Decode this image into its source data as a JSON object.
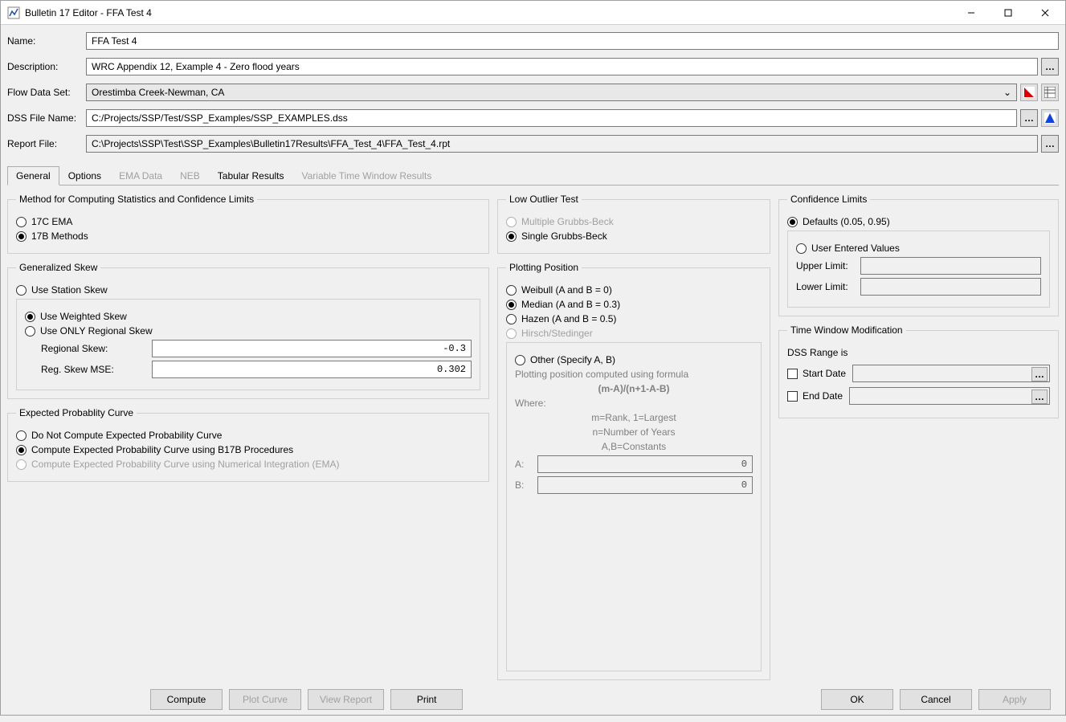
{
  "window": {
    "title": "Bulletin 17 Editor - FFA Test 4"
  },
  "form": {
    "name_label": "Name:",
    "name_value": "FFA Test 4",
    "desc_label": "Description:",
    "desc_value": "WRC Appendix 12, Example 4 - Zero flood years",
    "flow_label": "Flow Data Set:",
    "flow_value": "Orestimba Creek-Newman, CA",
    "dss_label": "DSS File Name:",
    "dss_value": "C:/Projects/SSP/Test/SSP_Examples/SSP_EXAMPLES.dss",
    "report_label": "Report File:",
    "report_value": "C:\\Projects\\SSP\\Test\\SSP_Examples\\Bulletin17Results\\FFA_Test_4\\FFA_Test_4.rpt"
  },
  "tabs": [
    "General",
    "Options",
    "EMA Data",
    "NEB",
    "Tabular Results",
    "Variable Time Window Results"
  ],
  "method_group": {
    "legend": "Method for Computing Statistics and Confidence Limits",
    "opt_17c": "17C EMA",
    "opt_17b": "17B Methods"
  },
  "skew_group": {
    "legend": "Generalized Skew",
    "station": "Use Station Skew",
    "weighted": "Use Weighted Skew",
    "regional_only": "Use ONLY Regional Skew",
    "regional_skew_label": "Regional Skew:",
    "regional_skew_value": "-0.3",
    "mse_label": "Reg. Skew MSE:",
    "mse_value": "0.302"
  },
  "expected_group": {
    "legend": "Expected Probablity Curve",
    "none": "Do Not Compute Expected Probability Curve",
    "b17b": "Compute Expected Probability Curve using B17B Procedures",
    "ema": "Compute Expected Probability Curve using Numerical Integration (EMA)"
  },
  "outlier_group": {
    "legend": "Low Outlier Test",
    "multiple": "Multiple Grubbs-Beck",
    "single": "Single Grubbs-Beck"
  },
  "plotting_group": {
    "legend": "Plotting Position",
    "weibull": "Weibull (A and B = 0)",
    "median": "Median (A and B = 0.3)",
    "hazen": "Hazen (A and B = 0.5)",
    "hirsch": "Hirsch/Stedinger",
    "other": "Other (Specify A, B)",
    "info1": "Plotting position computed using formula",
    "formula": "(m-A)/(n+1-A-B)",
    "where": "Where:",
    "m_rank": "m=Rank, 1=Largest",
    "n_years": "n=Number of Years",
    "ab_const": "A,B=Constants",
    "a_label": "A:",
    "a_value": "0",
    "b_label": "B:",
    "b_value": "0"
  },
  "conf_group": {
    "legend": "Confidence Limits",
    "defaults": "Defaults (0.05, 0.95)",
    "user": "User Entered Values",
    "upper_label": "Upper Limit:",
    "lower_label": "Lower Limit:"
  },
  "time_group": {
    "legend": "Time Window Modification",
    "range_label": "DSS Range is",
    "start_date": "Start Date",
    "end_date": "End Date"
  },
  "buttons": {
    "compute": "Compute",
    "plot": "Plot Curve",
    "view": "View Report",
    "print": "Print",
    "ok": "OK",
    "cancel": "Cancel",
    "apply": "Apply"
  },
  "glyphs": {
    "browse": "…",
    "dropdown": "⌄"
  }
}
